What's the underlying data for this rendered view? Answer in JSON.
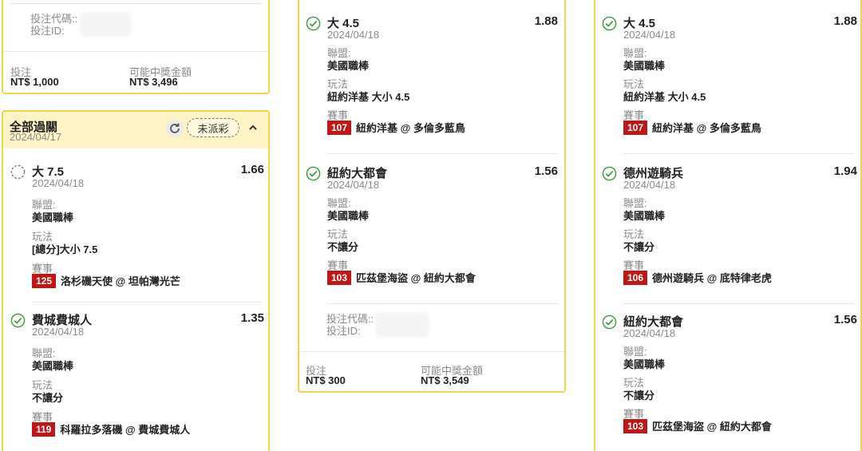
{
  "labels": {
    "league": "聯盟:",
    "play": "玩法",
    "match": "賽事",
    "bet_code": "投注代碼::",
    "bet_id": "投注ID:",
    "stake": "投注",
    "potential_win": "可能中獎金額"
  },
  "colors": {
    "accent_border": "#f2d34a",
    "header_bg": "#fdf3c4",
    "badge_red": "#c21515",
    "check_green": "#3c9a3c"
  },
  "left_top_card": {
    "stake_value": "NT$ 1,000",
    "win_value": "NT$ 3,496"
  },
  "parlay_card": {
    "title": "全部過關",
    "date": "2024/04/17",
    "status": "未派彩",
    "refresh_icon": "refresh-icon",
    "collapse_icon": "chevron-up-icon",
    "legs": [
      {
        "status": "pending",
        "name": "大 7.5",
        "odds": "1.66",
        "date": "2024/04/18",
        "league": "美國職棒",
        "play": "[總分]大小 7.5",
        "match_no": "125",
        "match": "洛杉磯天使 @ 坦帕灣光芒"
      },
      {
        "status": "won",
        "name": "費城費城人",
        "odds": "1.35",
        "date": "2024/04/18",
        "league": "美國職棒",
        "play": "不讓分",
        "match_no": "119",
        "match": "科羅拉多落磯 @ 費城費城人"
      }
    ]
  },
  "middle_card": {
    "legs": [
      {
        "status": "won",
        "name": "大 4.5",
        "odds": "1.88",
        "date": "2024/04/18",
        "league": "美國職棒",
        "play": "紐約洋基 大小 4.5",
        "match_no": "107",
        "match": "紐約洋基 @ 多倫多藍鳥"
      },
      {
        "status": "won",
        "name": "紐約大都會",
        "odds": "1.56",
        "date": "2024/04/18",
        "league": "美國職棒",
        "play": "不讓分",
        "match_no": "103",
        "match": "匹茲堡海盜 @ 紐約大都會"
      }
    ],
    "stake_value": "NT$ 300",
    "win_value": "NT$ 3,549"
  },
  "right_card": {
    "legs": [
      {
        "status": "won",
        "name": "大 4.5",
        "odds": "1.88",
        "date": "2024/04/18",
        "league": "美國職棒",
        "play": "紐約洋基 大小 4.5",
        "match_no": "107",
        "match": "紐約洋基 @ 多倫多藍鳥"
      },
      {
        "status": "won",
        "name": "德州遊騎兵",
        "odds": "1.94",
        "date": "2024/04/18",
        "league": "美國職棒",
        "play": "不讓分",
        "match_no": "106",
        "match": "德州遊騎兵 @ 底特律老虎"
      },
      {
        "status": "won",
        "name": "紐約大都會",
        "odds": "1.56",
        "date": "2024/04/18",
        "league": "美國職棒",
        "play": "不讓分",
        "match_no": "103",
        "match": "匹茲堡海盜 @ 紐約大都會"
      }
    ]
  }
}
